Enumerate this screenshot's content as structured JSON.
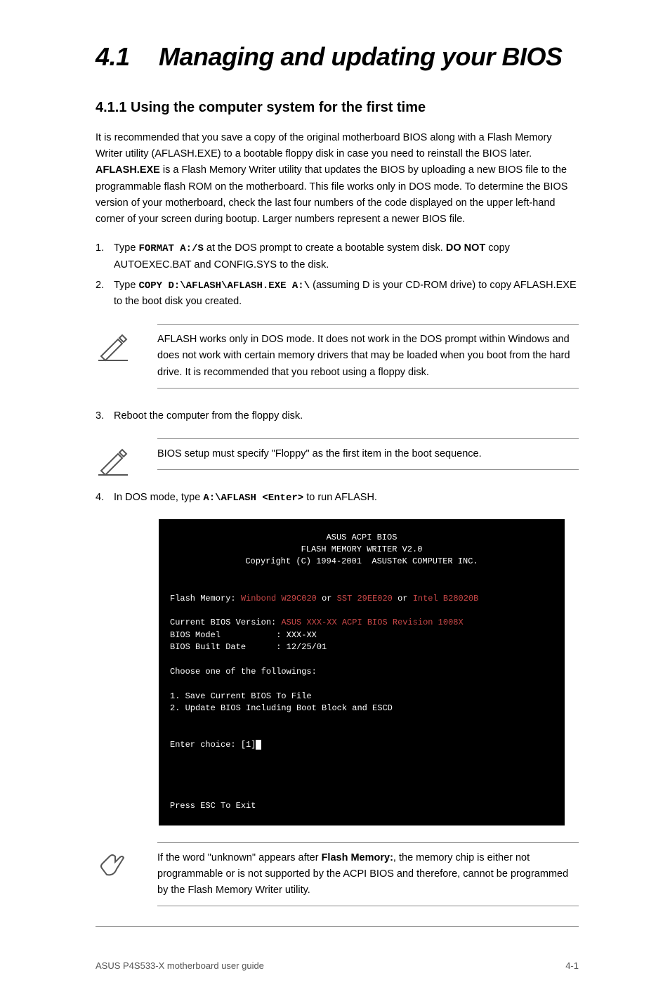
{
  "heading": {
    "number": "4.1",
    "title": "Managing and updating your BIOS"
  },
  "subheading": "4.1.1  Using the computer system for the first time",
  "intro_p1": "It is recommended that you save a copy of the original motherboard BIOS along with a Flash Memory Writer utility (AFLASH.EXE) to a bootable floppy disk in case you need to reinstall the BIOS later. AFLASH.EXE is a Flash Memory Writer utility that updates the BIOS by uploading a new BIOS file to the programmable flash ROM on the motherboard. This file works only in DOS mode. To determine the BIOS version of your motherboard, check the last four numbers of the code displayed on the upper left-hand corner of your screen during bootup. Larger numbers represent a newer BIOS file.",
  "steps_a": [
    "Type FORMAT A:/S at the DOS prompt to create a bootable system disk. DO NOT copy AUTOEXEC.BAT and CONFIG.SYS to the disk.",
    "Type COPY D:\\AFLASH\\AFLASH.EXE A:\\ (assuming D is your CD-ROM drive) to copy AFLASH.EXE to the boot disk you created."
  ],
  "note1": "AFLASH works only in DOS mode. It does not work in the DOS prompt within Windows and does not work with certain memory drivers that may be loaded when you boot from the hard drive. It is recommended that you reboot using a floppy disk.",
  "steps_b": [
    "Reboot the computer from the floppy disk."
  ],
  "note2": "BIOS setup must specify \"Floppy\" as the first item in the boot sequence.",
  "steps_c_prefix": "In DOS mode, type A:\\AFLASH <Enter> to run AFLASH.",
  "terminal": {
    "title1": "ASUS ACPI BIOS",
    "title2": "FLASH MEMORY WRITER V2.0",
    "title3": "Copyright (C) 1994-2001  ASUSTeK COMPUTER INC.",
    "flash_label": "Flash Memory:",
    "mem1": "Winbond W29C020",
    "or": "or",
    "mem2": "SST 29EE020",
    "mem3": "Intel B28020B",
    "cur_ver_label": "Current BIOS Version:",
    "cur_ver_val": "ASUS XXX-XX ACPI BIOS Revision 1008X",
    "model_label": "BIOS Model",
    "model_val": ": XXX-XX",
    "built_label": "BIOS Built Date",
    "built_val": ": 12/25/01",
    "choose": "Choose one of the followings:",
    "opt1": "1. Save Current BIOS To File",
    "opt2": "2. Update BIOS Including Boot Block and ESCD",
    "enter": "Enter choice: [1]",
    "esc": "Press ESC To Exit"
  },
  "note3": "If the word \"unknown\" appears after Flash Memory:, the memory chip is either not programmable or is not supported by the ACPI BIOS and therefore, cannot be programmed by the Flash Memory Writer utility.",
  "footer": {
    "left": "ASUS P4S533-X motherboard user guide",
    "right": "4-1"
  }
}
